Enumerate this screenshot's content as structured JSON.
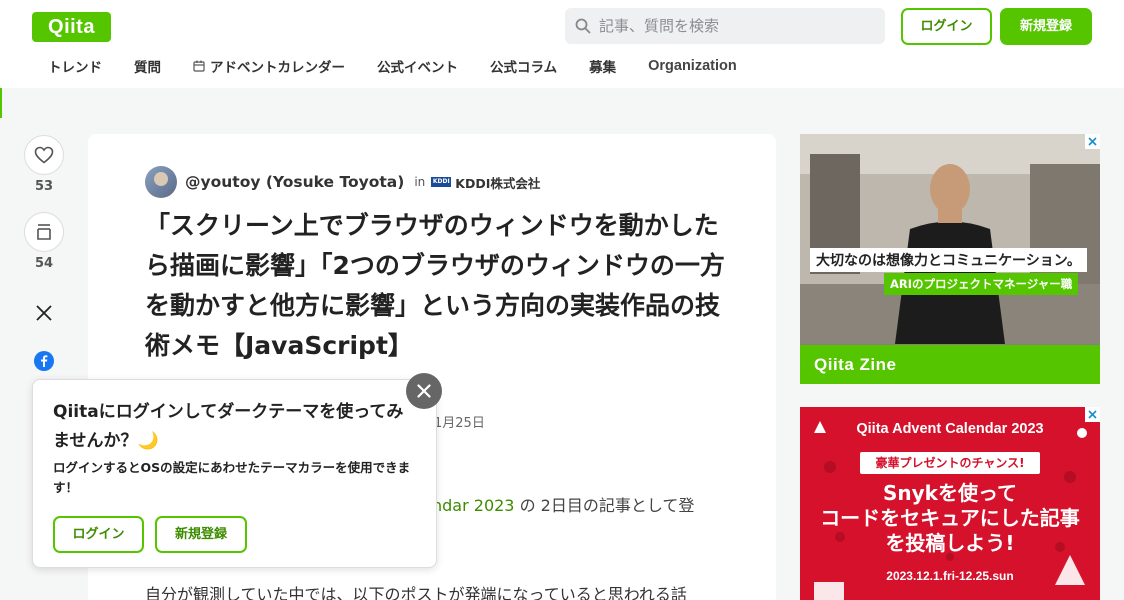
{
  "header": {
    "logo": "Qiita",
    "search_placeholder": "記事、質問を検索",
    "login_label": "ログイン",
    "signup_label": "新規登録"
  },
  "nav": {
    "items": [
      "トレンド",
      "質問",
      "アドベントカレンダー",
      "公式イベント",
      "公式コラム",
      "募集",
      "Organization"
    ]
  },
  "side": {
    "like_count": "53",
    "stock_count": "54"
  },
  "article": {
    "author": "@youtoy (Yosuke Toyota)",
    "in_label": "in",
    "org_logo": "KDDI",
    "org_name": "KDDI株式会社",
    "title": "「スクリーン上でブラウザのウィンドウを動かしたら描画に影響」「2つのブラウザのウィンドウの一方を動かすと他方に影響」という方向の実装作品の技術メモ【JavaScript】",
    "date_partial": "1月25日",
    "body_link_partial": "ndar 2023",
    "body_partial": " の 2日目の記事として登",
    "body2": "自分が観測していた中では、以下のポストが発端になっていると思われる話"
  },
  "popup": {
    "title": "Qiitaにログインしてダークテーマを使ってみませんか？🌙",
    "desc": "ログインするとOSの設定にあわせたテーマカラーを使用できます！",
    "login_label": "ログイン",
    "signup_label": "新規登録"
  },
  "ads": {
    "ad1_caption": "大切なのは想像力とコミュニケーション。",
    "ad1_sub": "ARIのプロジェクトマネージャー職",
    "ad1_brand": "Qiita Zine",
    "ad2_title": "Qiita Advent Calendar 2023",
    "ad2_badge": "豪華プレゼントのチャンス!",
    "ad2_line1": "Snykを使って",
    "ad2_line2": "コードをセキュアにした記事",
    "ad2_line3": "を投稿しよう!",
    "ad2_date": "2023.12.1.fri-12.25.sun"
  },
  "colors": {
    "brand_green": "#55c500",
    "ad_red": "#d5112b"
  }
}
